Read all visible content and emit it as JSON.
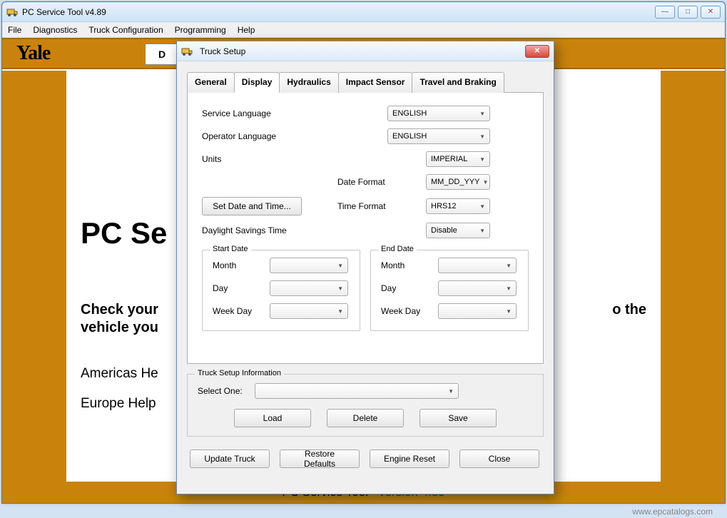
{
  "window": {
    "title": "PC Service Tool v4.89",
    "min": "—",
    "max": "□",
    "close": "✕"
  },
  "menu": {
    "file": "File",
    "diagnostics": "Diagnostics",
    "truck_config": "Truck Configuration",
    "programming": "Programming",
    "help": "Help"
  },
  "brand": {
    "logo": "Yale",
    "band_letter": "D"
  },
  "content": {
    "heading": "PC Se",
    "paragraph_l": "Check your",
    "paragraph_r": "o the",
    "paragraph2": "vehicle you",
    "link1": "Americas He",
    "link2": "Europe Help"
  },
  "footer": {
    "tool": "PC Service Tool",
    "dash": " - ",
    "version": "version 4.89"
  },
  "watermark": "www.epcatalogs.com",
  "dialog": {
    "title": "Truck Setup",
    "tabs": {
      "general": "General",
      "display": "Display",
      "hydraulics": "Hydraulics",
      "impact": "Impact Sensor",
      "travel": "Travel and Braking"
    },
    "display": {
      "service_lang_label": "Service Language",
      "service_lang_value": "ENGLISH",
      "operator_lang_label": "Operator Language",
      "operator_lang_value": "ENGLISH",
      "units_label": "Units",
      "units_value": "IMPERIAL",
      "date_format_label": "Date Format",
      "date_format_value": "MM_DD_YYY",
      "time_format_label": "Time Format",
      "time_format_value": "HRS12",
      "set_datetime_btn": "Set Date and Time...",
      "dst_label": "Daylight Savings Time",
      "dst_value": "Disable",
      "start_date_legend": "Start Date",
      "end_date_legend": "End Date",
      "month_label": "Month",
      "day_label": "Day",
      "weekday_label": "Week Day"
    },
    "info": {
      "legend": "Truck Setup Information",
      "select_one": "Select One:",
      "load": "Load",
      "delete": "Delete",
      "save": "Save"
    },
    "bottom": {
      "update": "Update Truck",
      "restore": "Restore Defaults",
      "engine": "Engine Reset",
      "close": "Close"
    }
  }
}
